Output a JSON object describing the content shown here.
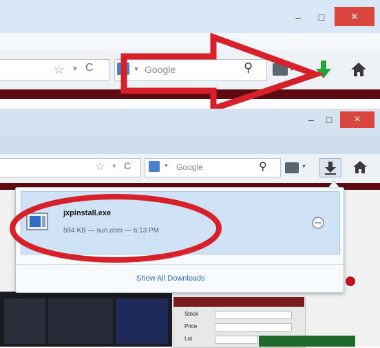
{
  "top_window": {
    "search_placeholder": "Google",
    "reload_glyph": "C",
    "minimize_glyph": "–",
    "maximize_glyph": "□",
    "close_glyph": "×",
    "download_icon": "green-download-arrow-icon",
    "home_icon": "home-icon"
  },
  "second_window": {
    "search_placeholder": "Google",
    "reload_glyph": "C",
    "minimize_glyph": "–",
    "maximize_glyph": "□",
    "close_glyph": "×"
  },
  "download_panel": {
    "file_name": "jxpinstall.exe",
    "details": "594 KB — sun.com — 6:13 PM",
    "show_all_label": "Show All Downloads"
  },
  "form": {
    "labels": [
      "Stock",
      "Price",
      "Lot"
    ]
  },
  "colors": {
    "close_red": "#d9463e",
    "annotation_red": "#d8202a",
    "download_green": "#28a339",
    "accent_blue": "#2f6ec3"
  }
}
